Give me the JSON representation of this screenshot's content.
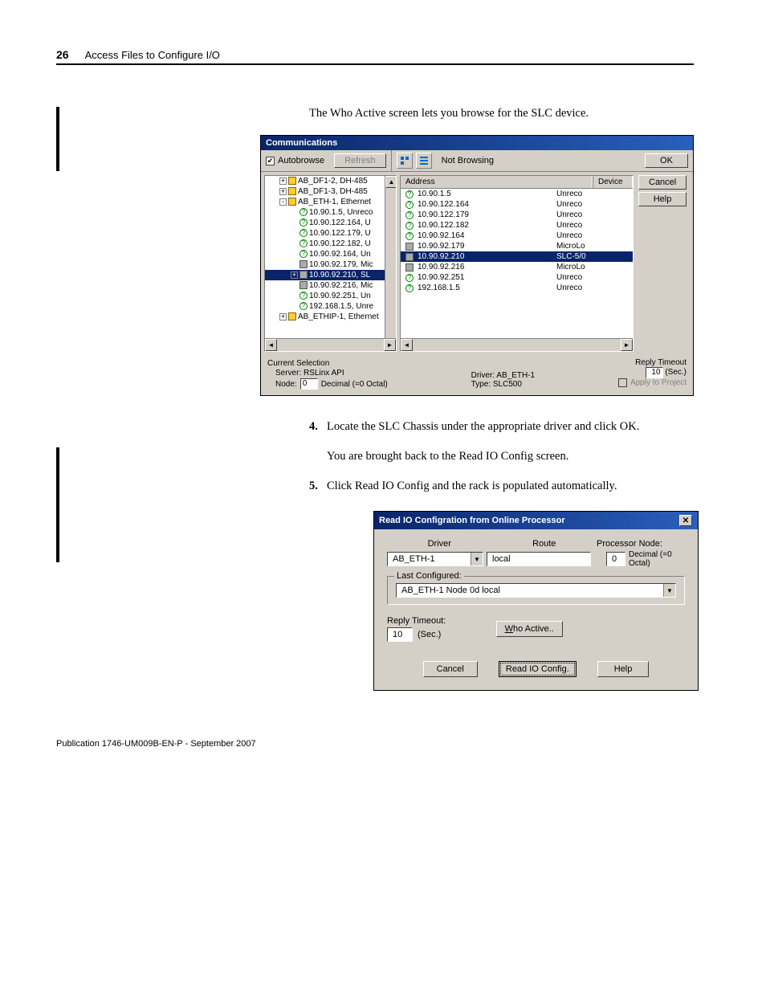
{
  "header": {
    "page_number": "26",
    "section": "Access Files to Configure I/O"
  },
  "intro_text": "The Who Active screen lets you browse for the SLC device.",
  "communications": {
    "title": "Communications",
    "autobrowse_label": "Autobrowse",
    "autobrowse_checked": true,
    "refresh_label": "Refresh",
    "status_text": "Not Browsing",
    "address_col": "Address",
    "device_col": "Device",
    "buttons": {
      "ok": "OK",
      "cancel": "Cancel",
      "help": "Help"
    },
    "tree": [
      {
        "indent": 1,
        "expand": "+",
        "icon": "net",
        "label": "AB_DF1-2, DH-485"
      },
      {
        "indent": 1,
        "expand": "+",
        "icon": "net",
        "label": "AB_DF1-3, DH-485"
      },
      {
        "indent": 1,
        "expand": "-",
        "icon": "net",
        "label": "AB_ETH-1, Ethernet"
      },
      {
        "indent": 2,
        "expand": "",
        "icon": "q",
        "label": "10.90.1.5, Unreco"
      },
      {
        "indent": 2,
        "expand": "",
        "icon": "q",
        "label": "10.90.122.164, U"
      },
      {
        "indent": 2,
        "expand": "",
        "icon": "q",
        "label": "10.90.122.179, U"
      },
      {
        "indent": 2,
        "expand": "",
        "icon": "q",
        "label": "10.90.122.182, U"
      },
      {
        "indent": 2,
        "expand": "",
        "icon": "q",
        "label": "10.90.92.164, Un"
      },
      {
        "indent": 2,
        "expand": "",
        "icon": "dev",
        "label": "10.90.92.179, Mic"
      },
      {
        "indent": 2,
        "expand": "+",
        "icon": "dev",
        "label": "10.90.92.210, SL",
        "selected": true
      },
      {
        "indent": 2,
        "expand": "",
        "icon": "dev",
        "label": "10.90.92.216, Mic"
      },
      {
        "indent": 2,
        "expand": "",
        "icon": "q",
        "label": "10.90.92.251, Un"
      },
      {
        "indent": 2,
        "expand": "",
        "icon": "q",
        "label": "192.168.1.5, Unre"
      },
      {
        "indent": 1,
        "expand": "+",
        "icon": "net",
        "label": "AB_ETHIP-1, Ethernet"
      }
    ],
    "list": [
      {
        "icon": "q",
        "address": "10.90.1.5",
        "device": "Unreco"
      },
      {
        "icon": "q",
        "address": "10.90.122.164",
        "device": "Unreco"
      },
      {
        "icon": "q",
        "address": "10.90.122.179",
        "device": "Unreco"
      },
      {
        "icon": "q",
        "address": "10.90.122.182",
        "device": "Unreco"
      },
      {
        "icon": "q",
        "address": "10.90.92.164",
        "device": "Unreco"
      },
      {
        "icon": "dev",
        "address": "10.90.92.179",
        "device": "MicroLo"
      },
      {
        "icon": "dev",
        "address": "10.90.92.210",
        "device": "SLC-5/0",
        "selected": true
      },
      {
        "icon": "dev",
        "address": "10.90.92.216",
        "device": "MicroLo"
      },
      {
        "icon": "q",
        "address": "10.90.92.251",
        "device": "Unreco"
      },
      {
        "icon": "q",
        "address": "192.168.1.5",
        "device": "Unreco"
      }
    ],
    "footer": {
      "current_selection_label": "Current Selection",
      "server_label": "Server:",
      "server_value": "RSLinx API",
      "node_label": "Node:",
      "node_value": "0",
      "node_format": "Decimal (=0 Octal)",
      "driver_label": "Driver:",
      "driver_value": "AB_ETH-1",
      "type_label": "Type:",
      "type_value": "SLC500",
      "reply_timeout_label": "Reply Timeout",
      "reply_timeout_value": "10",
      "reply_timeout_unit": "(Sec.)",
      "apply_label": "Apply to Project"
    }
  },
  "step4": {
    "num": "4.",
    "text": "Locate the SLC Chassis under the appropriate driver and click OK.",
    "followup": "You are brought back to the Read IO Config screen."
  },
  "step5": {
    "num": "5.",
    "text": "Click Read IO Config and the rack is populated automatically."
  },
  "readio": {
    "title": "Read IO Configration from Online Processor",
    "driver_heading": "Driver",
    "route_heading": "Route",
    "processor_node_label": "Processor Node:",
    "driver_value": "AB_ETH-1",
    "route_value": "local",
    "node_value": "0",
    "node_format": "Decimal (=0 Octal)",
    "last_configured_label": "Last Configured:",
    "last_configured_value": "AB_ETH-1      Node 0d   local",
    "reply_timeout_label": "Reply Timeout:",
    "reply_timeout_value": "10",
    "reply_timeout_unit": "(Sec.)",
    "who_active_btn": "Who Active..",
    "cancel_btn": "Cancel",
    "read_btn": "Read IO Config.",
    "help_btn": "Help"
  },
  "pubfooter": "Publication 1746-UM009B-EN-P - September 2007"
}
